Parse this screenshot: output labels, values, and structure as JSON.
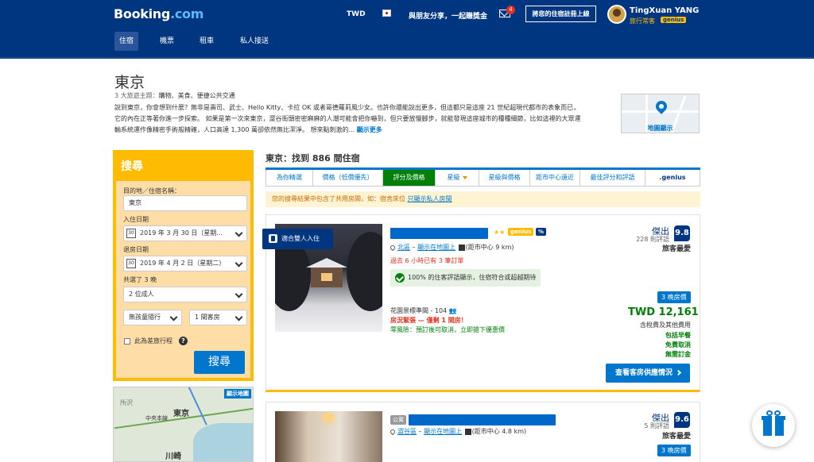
{
  "header": {
    "logo_main": "Booking",
    "logo_dot": ".com",
    "currency": "TWD",
    "share": "與朋友分享，一起賺獎金",
    "mail_count": "4",
    "list_property": "將您的住宿註冊上線",
    "user_name": "TingXuan YANG",
    "user_level": "旅行常客",
    "genius": "genius"
  },
  "nav": [
    "住宿",
    "機票",
    "租車",
    "私人接送"
  ],
  "destination": {
    "city": "東京",
    "themes_prefix": "3 大旅遊主題：",
    "themes": "購物、美食、便捷公共交通",
    "description": "說到東京，你會想到什麼？無非是壽司、武士、Hello Kitty、卡拉 OK 或者哥德蘿莉風少女。也許你還能說出更多，但這都只是這座 21 世紀超現代都市的表象而已，它的內在正等著你進一步探索。 如果是第一次來東京，澀谷街頭密密麻麻的人潮可能會把你嚇到，但只要放慢腳步，就能發現這座城市的種種細節，比如這裡的大眾運輸系統運作像精密手術般精確，人口高達 1,300 萬卻依然無比潔淨。 想來點刺激的...",
    "read_more": "顯示更多",
    "map_label": "地圖顯示"
  },
  "search": {
    "title": "搜尋",
    "dest_label": "目的地／住宿名稱：",
    "dest_value": "東京",
    "checkin_label": "入住日期",
    "checkin_value": "2019 年 3 月 30 日（星期...",
    "checkout_label": "退房日期",
    "checkout_value": "2019 年 4 月 2 日（星期二）",
    "nights": "共選了 3 晚",
    "adults": "2 位成人",
    "children": "無孩童隨行",
    "rooms": "1 間客房",
    "business": "此為差旅行程",
    "button": "搜尋",
    "cal_icon": "30"
  },
  "minimap": {
    "button": "顯示地圖",
    "labels": [
      "所沢",
      "東京",
      "中央本線",
      "川崎"
    ]
  },
  "results": {
    "title": "東京：找到 886 間住宿",
    "sort_tabs": [
      {
        "label": "為你精選"
      },
      {
        "label": "價格（低價優先）"
      },
      {
        "label": "評分及價格"
      },
      {
        "label": "星級"
      },
      {
        "label": "星級與價格"
      },
      {
        "label": "距市中心遠近"
      },
      {
        "label": "最佳評分和評語"
      },
      {
        "label": ".genius"
      }
    ],
    "notice": "您的搜尋結果中包含了共用房間，如：宿舍床位",
    "notice_link": "只顯示私人房間"
  },
  "card1": {
    "ribbon": "適合雙人入住",
    "stars": "★★",
    "genius": "genius",
    "percent": "%",
    "district": "北區",
    "map_link": "顯示在地圖上",
    "distance": "(距市中心 9 km)",
    "recent": "過去 6 小時已有 3 筆訂單",
    "approve": "100% 的住客評語顯示，住宿符合或超越期待",
    "room": "花園景標準間 - 104",
    "warning": "房況緊張 — 僅剩 1 間房！",
    "cancel": "零風險：預訂後可取消，立即搶下優惠價",
    "score_word": "傑出",
    "review_count": "228 則評語",
    "score": "9.8",
    "score_sub": "旅客最愛",
    "nights": "3 晚房價",
    "price": "TWD 12,161",
    "tax": "含稅費及其他費用",
    "perks": [
      "包括早餐",
      "免費取消",
      "無需訂金"
    ],
    "cta": "查看客房供應情況"
  },
  "card2": {
    "tag": "公寓",
    "district": "澀谷區",
    "map_link": "顯示在地圖上",
    "distance": "(距市中心 4.8 km)",
    "score_word": "傑出",
    "review_count": "5 則評語",
    "score": "9.6",
    "score_sub": "旅客最愛",
    "nights": "3 晚房價"
  },
  "colors": {
    "brand_blue": "#003580",
    "link_blue": "#0077cc",
    "search_yellow": "#febb02",
    "green": "#008009",
    "red": "#e3301d"
  }
}
